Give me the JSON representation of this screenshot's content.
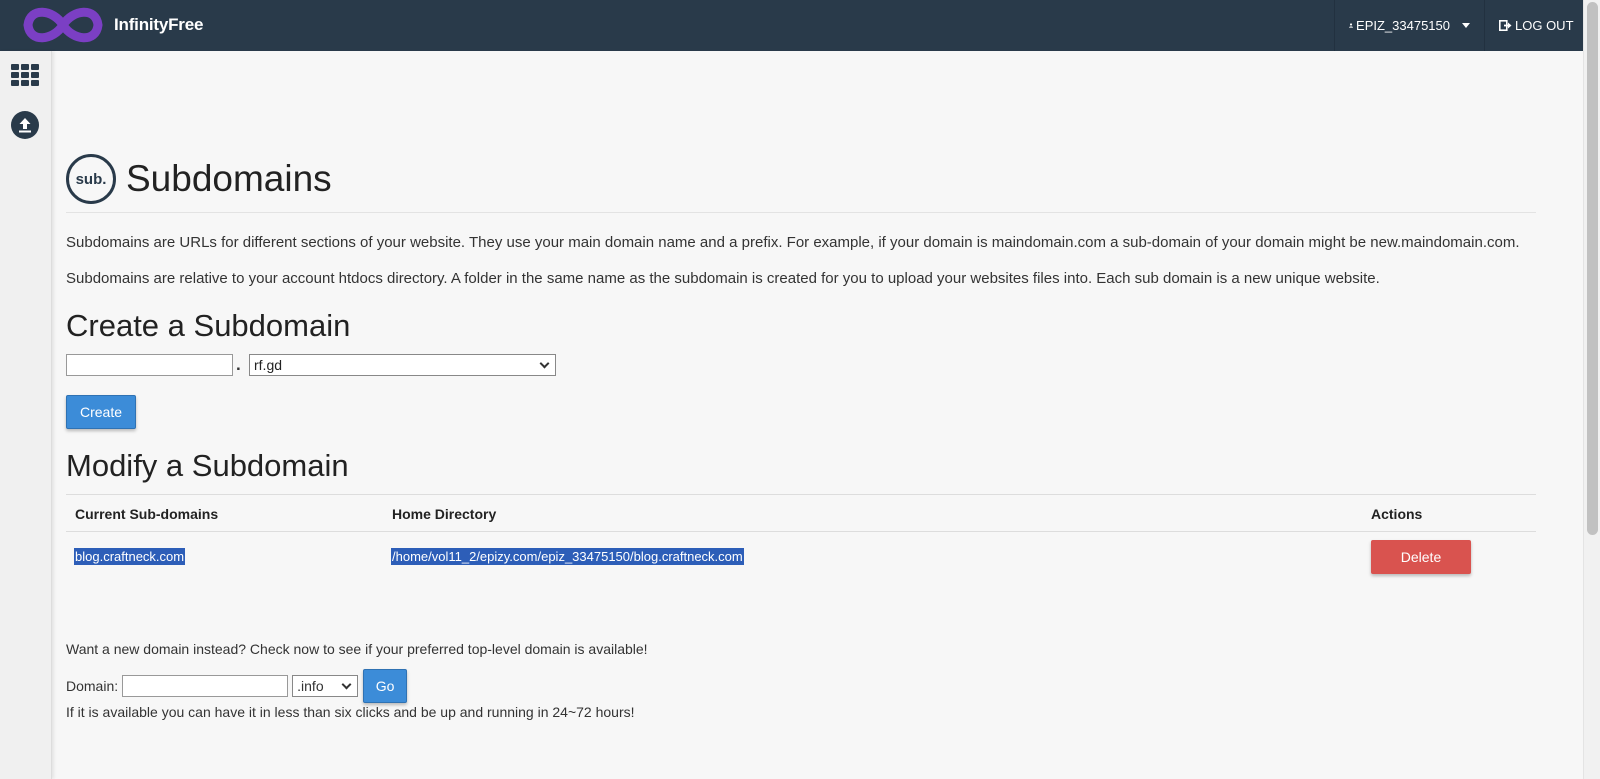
{
  "header": {
    "brand": "InfinityFree",
    "username": "EPIZ_33475150",
    "logout_label": "LOG OUT"
  },
  "sidebar": {
    "items": [
      {
        "icon": "apps-grid-icon"
      },
      {
        "icon": "upload-icon"
      }
    ]
  },
  "page": {
    "icon_text": "sub.",
    "title": "Subdomains",
    "intro1": "Subdomains are URLs for different sections of your website. They use your main domain name and a prefix. For example, if your domain is maindomain.com a sub-domain of your domain might be new.maindomain.com.",
    "intro2": "Subdomains are relative to your account htdocs directory. A folder in the same name as the subdomain is created for you to upload your websites files into. Each sub domain is a new unique website."
  },
  "create": {
    "heading": "Create a Subdomain",
    "subdomain_value": "",
    "separator": ".",
    "domain_selected": "rf.gd",
    "button": "Create"
  },
  "modify": {
    "heading": "Modify a Subdomain",
    "columns": [
      "Current Sub-domains",
      "Home Directory",
      "Actions"
    ],
    "rows": [
      {
        "subdomain": "blog.craftneck.com",
        "home_dir": "/home/vol11_2/epizy.com/epiz_33475150/blog.craftneck.com",
        "action": "Delete"
      }
    ]
  },
  "domain_search": {
    "promo": "Want a new domain instead? Check now to see if your preferred top-level domain is available!",
    "label": "Domain:",
    "value": "",
    "tld_selected": ".info",
    "button": "Go",
    "note": "If it is available you can have it in less than six clicks and be up and running in 24~72 hours!"
  },
  "colors": {
    "topbar": "#293a4a",
    "primary_button": "#3c8cd8",
    "danger_button": "#d9534f",
    "selection": "#2d5eb8",
    "brand_purple": "#7b3fc4"
  }
}
